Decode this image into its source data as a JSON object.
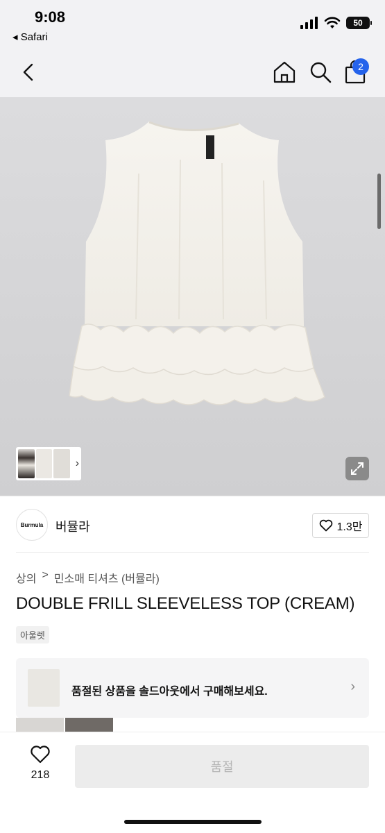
{
  "status_bar": {
    "time": "9:08",
    "back_app": "◂ Safari",
    "battery": "50"
  },
  "nav": {
    "cart_count": "2"
  },
  "brand": {
    "logo_text": "Burmula",
    "name": "버뮬라",
    "like_count": "1.3만"
  },
  "breadcrumb": {
    "category": "상의",
    "separator": ">",
    "subcategory": "민소매 티셔츠 (버뮬라)"
  },
  "product": {
    "title": "DOUBLE FRILL SLEEVELESS TOP (CREAM)",
    "tag": "아울렛"
  },
  "soldout_banner": {
    "text": "품절된 상품을 솔드아웃에서 구매해보세요."
  },
  "bottom_bar": {
    "wish_count": "218",
    "buy_label": "품절"
  },
  "colors": {
    "accent": "#2563eb",
    "product_cream": "#f3f0ea"
  }
}
